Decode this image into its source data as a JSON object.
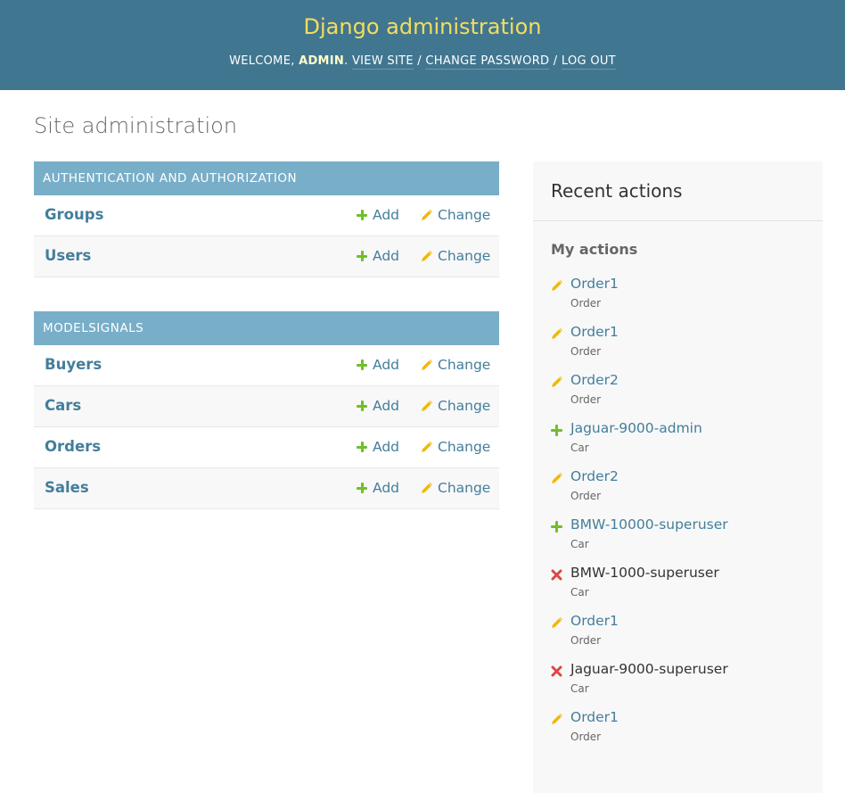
{
  "header": {
    "branding": "Django administration",
    "welcome": "WELCOME,",
    "username": "ADMIN",
    "view_site": "VIEW SITE",
    "change_password": "CHANGE PASSWORD",
    "log_out": "LOG OUT",
    "separator": "/"
  },
  "page_title": "Site administration",
  "apps": [
    {
      "caption": "Authentication and Authorization",
      "models": [
        {
          "name": "Groups",
          "add": "Add",
          "change": "Change"
        },
        {
          "name": "Users",
          "add": "Add",
          "change": "Change"
        }
      ]
    },
    {
      "caption": "Modelsignals",
      "models": [
        {
          "name": "Buyers",
          "add": "Add",
          "change": "Change"
        },
        {
          "name": "Cars",
          "add": "Add",
          "change": "Change"
        },
        {
          "name": "Orders",
          "add": "Add",
          "change": "Change"
        },
        {
          "name": "Sales",
          "add": "Add",
          "change": "Change"
        }
      ]
    }
  ],
  "recent_actions": {
    "title": "Recent actions",
    "subtitle": "My actions",
    "items": [
      {
        "action": "change",
        "name": "Order1",
        "type": "Order"
      },
      {
        "action": "change",
        "name": "Order1",
        "type": "Order"
      },
      {
        "action": "change",
        "name": "Order2",
        "type": "Order"
      },
      {
        "action": "add",
        "name": "Jaguar-9000-admin",
        "type": "Car"
      },
      {
        "action": "change",
        "name": "Order2",
        "type": "Order"
      },
      {
        "action": "add",
        "name": "BMW-10000-superuser",
        "type": "Car"
      },
      {
        "action": "delete",
        "name": "BMW-1000-superuser",
        "type": "Car"
      },
      {
        "action": "change",
        "name": "Order1",
        "type": "Order"
      },
      {
        "action": "delete",
        "name": "Jaguar-9000-superuser",
        "type": "Car"
      },
      {
        "action": "change",
        "name": "Order1",
        "type": "Order"
      }
    ]
  },
  "colors": {
    "header_bg": "#417690",
    "branding": "#f5dd5d",
    "caption_bg": "#79aec8",
    "link": "#447e9b",
    "add_icon": "#70bf2b",
    "change_icon": "#efb80b",
    "delete_icon": "#dd4646"
  },
  "icons": {
    "add": "plus-icon",
    "change": "pencil-icon",
    "delete": "cross-icon"
  }
}
